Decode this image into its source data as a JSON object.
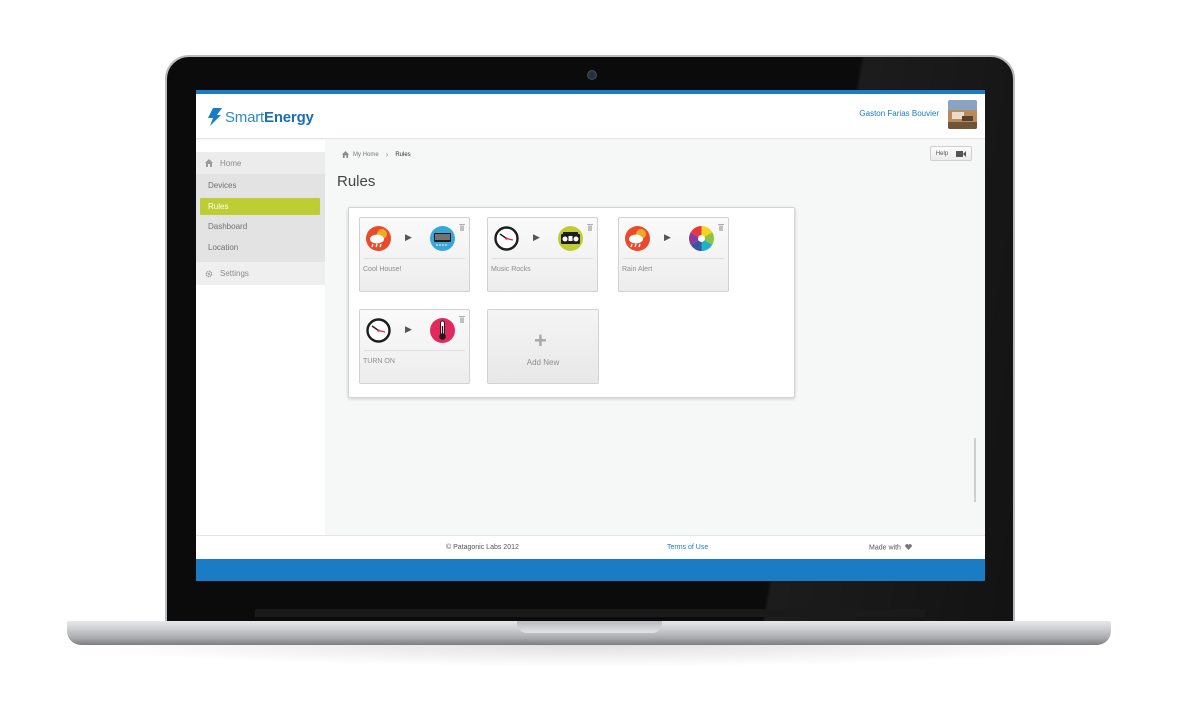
{
  "brand": {
    "name_light": "Smart",
    "name_bold": "Energy",
    "accent": "#1a7cc4",
    "active": "#bfcd35"
  },
  "user": {
    "name": "Gaston Farias Bouvier"
  },
  "sidebar": {
    "home": "Home",
    "items": [
      {
        "label": "Devices"
      },
      {
        "label": "Rules"
      },
      {
        "label": "Dashboard"
      },
      {
        "label": "Location"
      }
    ],
    "settings": "Settings"
  },
  "breadcrumb": {
    "home": "My Home",
    "current": "Rules"
  },
  "help": {
    "label": "Help"
  },
  "page": {
    "title": "Rules"
  },
  "rules": [
    {
      "label": "Cool House!",
      "trigger": "weather-icon",
      "action": "air-conditioner-icon"
    },
    {
      "label": "Music Rocks",
      "trigger": "clock-icon",
      "action": "stereo-icon"
    },
    {
      "label": "Rain Alert",
      "trigger": "weather-icon",
      "action": "color-wheel-icon"
    },
    {
      "label": "TURN ON",
      "trigger": "clock-icon",
      "action": "thermometer-icon"
    }
  ],
  "add_new": {
    "label": "Add New"
  },
  "footer": {
    "copyright": "© Patagonic Labs 2012",
    "terms": "Terms of Use",
    "made_with": "Made with"
  }
}
